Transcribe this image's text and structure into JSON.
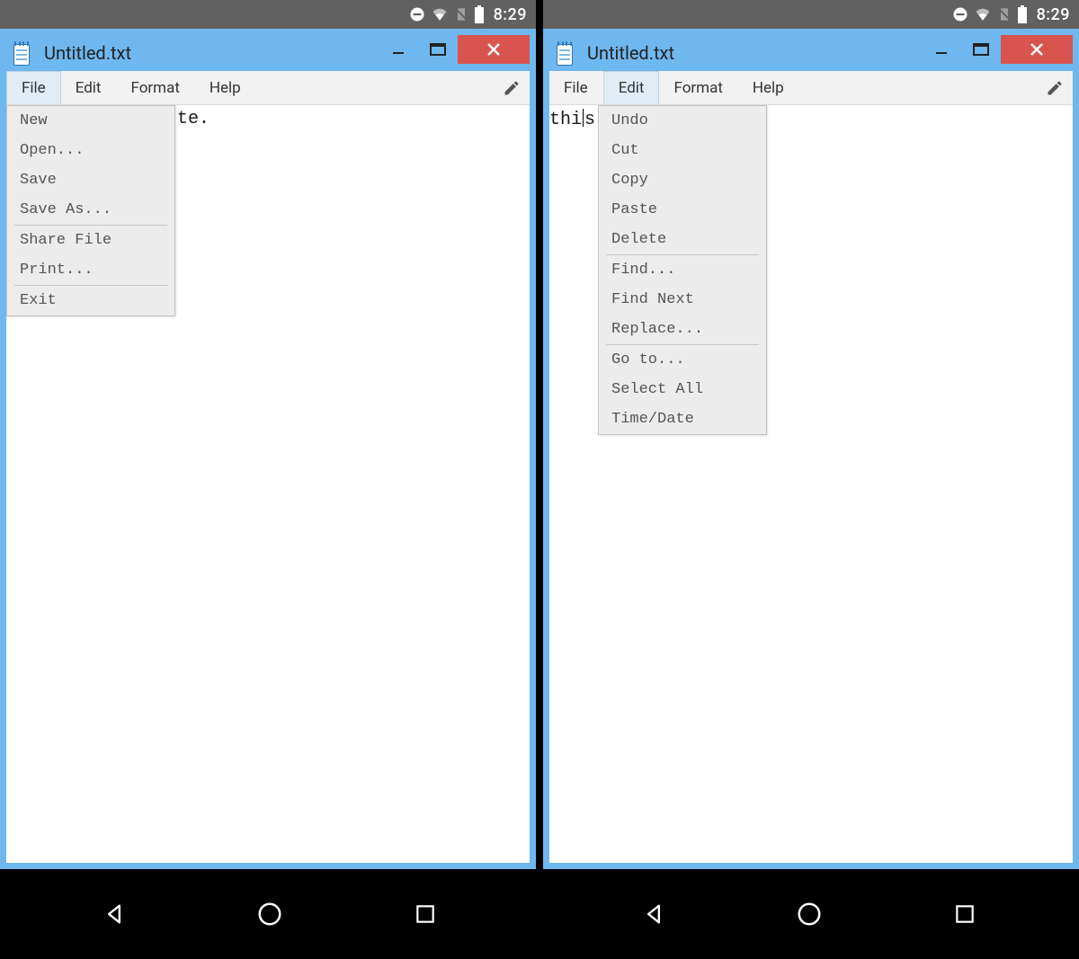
{
  "status": {
    "time": "8:29"
  },
  "window": {
    "title": "Untitled.txt"
  },
  "menubar": {
    "file": "File",
    "edit": "Edit",
    "format": "Format",
    "help": "Help"
  },
  "left": {
    "visible_text_fragment": "te.",
    "file_menu": {
      "new": "New",
      "open": "Open...",
      "save": "Save",
      "save_as": "Save As...",
      "share_file": "Share File",
      "print": "Print...",
      "exit": "Exit"
    }
  },
  "right": {
    "visible_text_before": "thi",
    "visible_text_after": "s",
    "edit_menu": {
      "undo": "Undo",
      "cut": "Cut",
      "copy": "Copy",
      "paste": "Paste",
      "delete": "Delete",
      "find": "Find...",
      "find_next": "Find Next",
      "replace": "Replace...",
      "go_to": "Go to...",
      "select_all": "Select All",
      "time_date": "Time/Date"
    }
  }
}
